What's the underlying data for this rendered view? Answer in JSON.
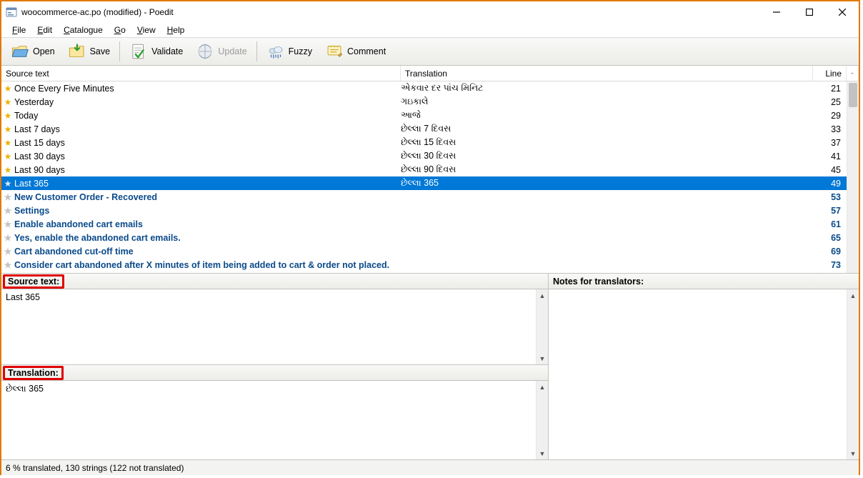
{
  "window": {
    "title": "woocommerce-ac.po (modified) - Poedit"
  },
  "menu": {
    "file": "File",
    "edit": "Edit",
    "catalogue": "Catalogue",
    "go": "Go",
    "view": "View",
    "help": "Help"
  },
  "toolbar": {
    "open": "Open",
    "save": "Save",
    "validate": "Validate",
    "update": "Update",
    "fuzzy": "Fuzzy",
    "comment": "Comment"
  },
  "columns": {
    "source": "Source text",
    "translation": "Translation",
    "line": "Line"
  },
  "rows": [
    {
      "star": true,
      "src": "Once Every Five Minutes",
      "tr": "એકવાર દર પાંચ મિનિટ",
      "ln": 21,
      "state": "normal"
    },
    {
      "star": true,
      "src": "Yesterday",
      "tr": "ગઇકાલે",
      "ln": 25,
      "state": "normal"
    },
    {
      "star": true,
      "src": "Today",
      "tr": "આજે",
      "ln": 29,
      "state": "normal"
    },
    {
      "star": true,
      "src": "Last 7 days",
      "tr": "છેલ્લા 7 દિવસ",
      "ln": 33,
      "state": "normal"
    },
    {
      "star": true,
      "src": "Last 15 days",
      "tr": "છેલ્લા 15 દિવસ",
      "ln": 37,
      "state": "normal"
    },
    {
      "star": true,
      "src": "Last 30 days",
      "tr": "છેલ્લા 30 દિવસ",
      "ln": 41,
      "state": "normal"
    },
    {
      "star": true,
      "src": "Last 90 days",
      "tr": "છેલ્લા 90 દિવસ",
      "ln": 45,
      "state": "normal"
    },
    {
      "star": true,
      "src": "Last 365",
      "tr": "છેલ્લા 365",
      "ln": 49,
      "state": "selected"
    },
    {
      "star": false,
      "src": "New Customer Order - Recovered",
      "tr": "",
      "ln": 53,
      "state": "untranslated"
    },
    {
      "star": false,
      "src": "Settings",
      "tr": "",
      "ln": 57,
      "state": "untranslated"
    },
    {
      "star": false,
      "src": "Enable abandoned cart emails",
      "tr": "",
      "ln": 61,
      "state": "untranslated"
    },
    {
      "star": false,
      "src": "Yes, enable the abandoned cart emails.",
      "tr": "",
      "ln": 65,
      "state": "untranslated"
    },
    {
      "star": false,
      "src": "Cart abandoned cut-off time",
      "tr": "",
      "ln": 69,
      "state": "untranslated"
    },
    {
      "star": false,
      "src": "Consider cart abandoned after X minutes of item being added to cart & order not placed.",
      "tr": "",
      "ln": 73,
      "state": "untranslated"
    }
  ],
  "panels": {
    "source_label": "Source text:",
    "translation_label": "Translation:",
    "notes_label": "Notes for translators:",
    "source_value": "Last 365",
    "translation_value": "છેલ્લા 365",
    "notes_value": ""
  },
  "status": {
    "text": "6 % translated, 130 strings (122 not translated)"
  }
}
